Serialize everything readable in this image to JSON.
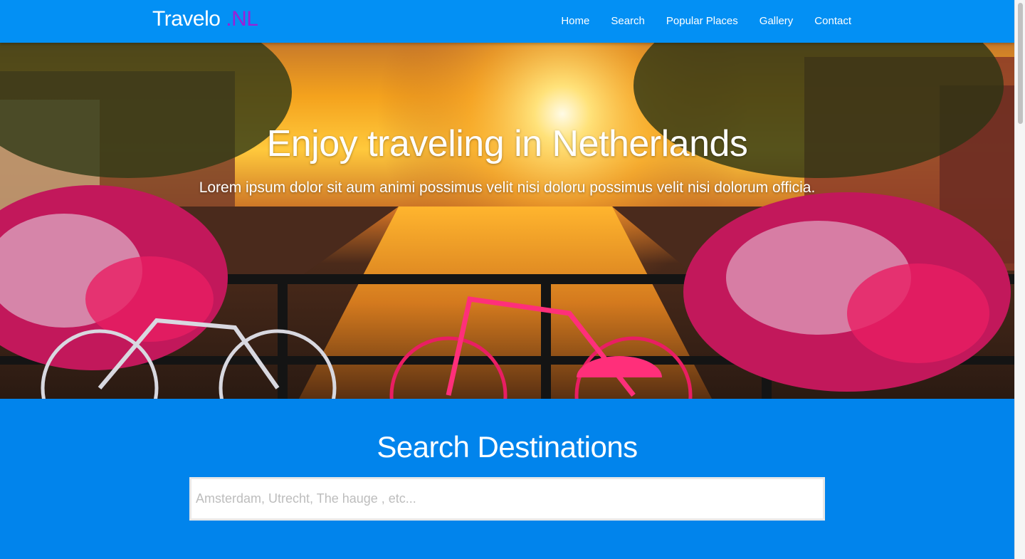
{
  "navbar": {
    "brand_main": "Travelo",
    "brand_accent": ".NL",
    "links": [
      "Home",
      "Search",
      "Popular Places",
      "Gallery",
      "Contact"
    ]
  },
  "hero": {
    "title": "Enjoy traveling in Netherlands",
    "subtitle": "Lorem ipsum dolor sit aum animi possimus velit nisi doloru possimus velit nisi dolorum officia.",
    "image_icon": "canal-sunset-photo"
  },
  "search": {
    "title": "Search Destinations",
    "placeholder": "Amsterdam, Utrecht, The hauge , etc...",
    "value": ""
  },
  "colors": {
    "navbar_bg": "#0390f4",
    "brand_accent": "#9c1fd6",
    "search_bg": "#0184ec"
  }
}
